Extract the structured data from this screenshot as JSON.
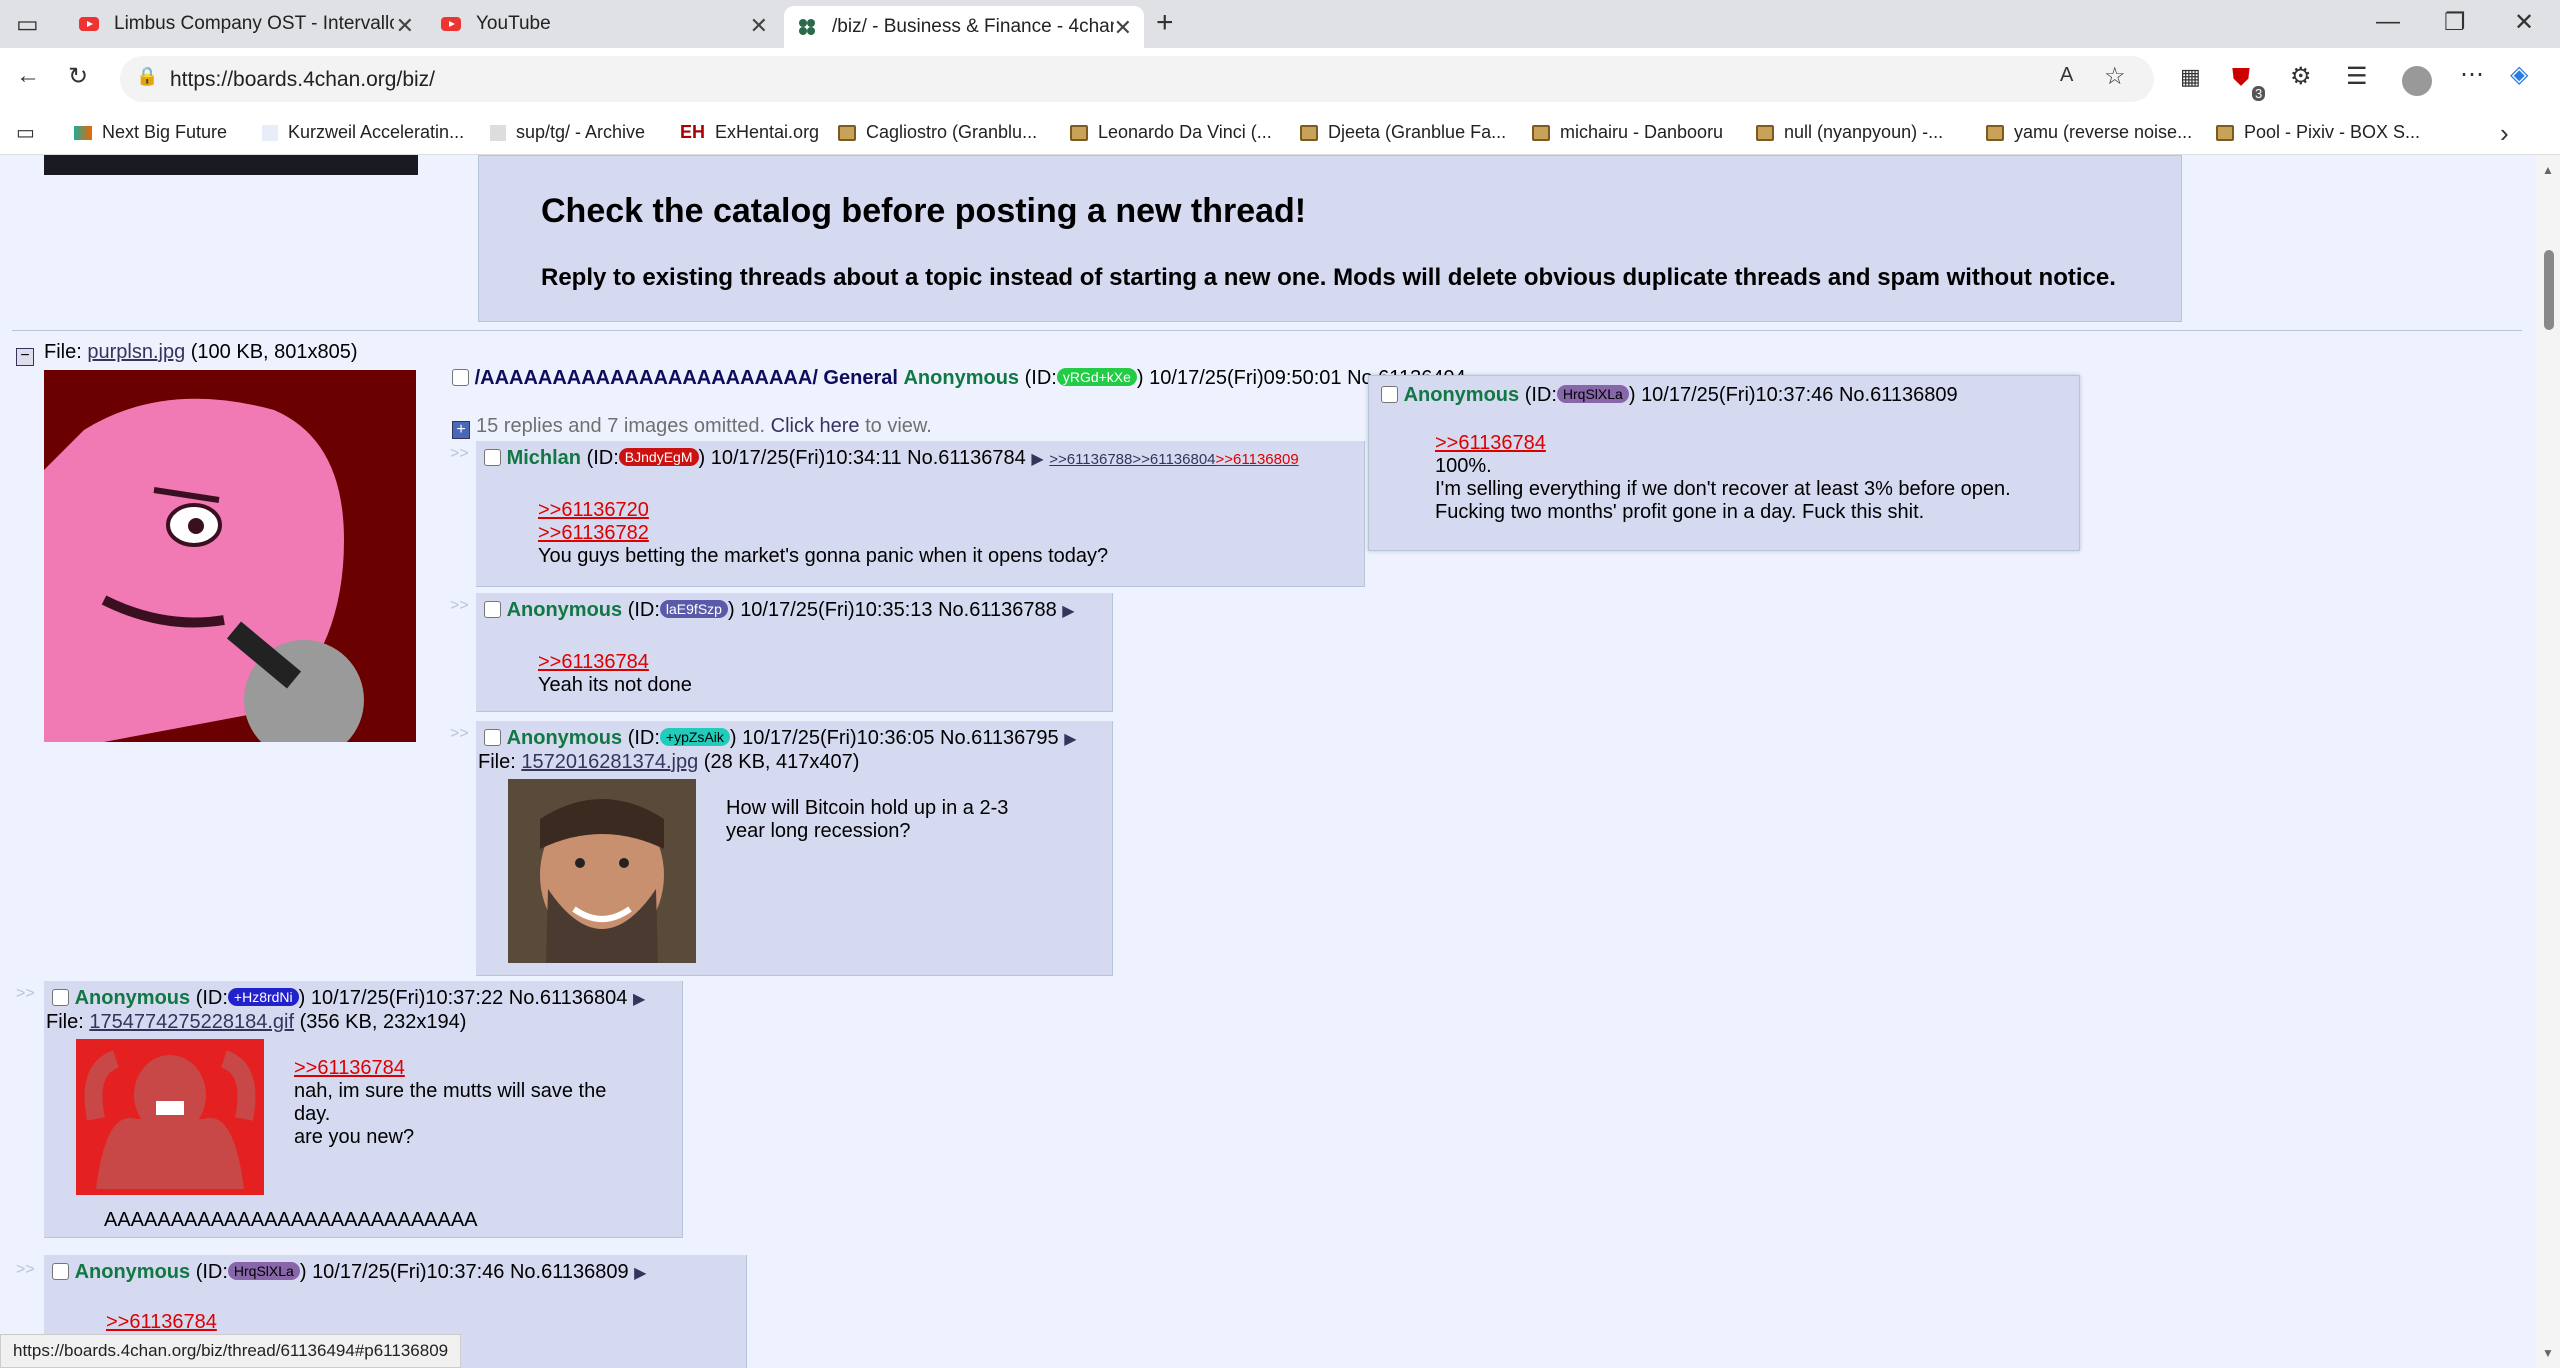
{
  "browser": {
    "tabs": [
      {
        "title": "Limbus Company OST - Intervallo",
        "icon": "youtube-icon"
      },
      {
        "title": "YouTube",
        "icon": "youtube-icon"
      },
      {
        "title": "/biz/ - Business & Finance - 4chan",
        "icon": "clover-icon"
      }
    ],
    "url": "https://boards.4chan.org/biz/",
    "bookmarks": [
      "Next Big Future",
      "Kurzweil Acceleratin...",
      "sup/tg/ - Archive",
      "ExHentai.org",
      "Cagliostro (Granblu...",
      "Leonardo Da Vinci (...",
      "Djeeta (Granblue Fa...",
      "michairu - Danbooru",
      "null (nyanpyoun) -...",
      "yamu (reverse noise...",
      "Pool - Pixiv - BOX S..."
    ],
    "extension_badge": "3"
  },
  "notice": {
    "title": "Check the catalog before posting a new thread!",
    "body": "Reply to existing threads about a topic instead of starting a new one. Mods will delete obvious duplicate threads and spam without notice."
  },
  "op": {
    "file_label": "File:",
    "file_name": "purplsn.jpg",
    "file_info": "(100 KB, 801x805)",
    "subject": "/AAAAAAAAAAAAAAAAAAAAAAA/ General",
    "name": "Anonymous",
    "id_prefix": "(ID:",
    "id": "yRGd+kXe",
    "id_suffix": ")",
    "datetime": "10/17/25(Fri)09:50:01",
    "postno": "No.61136494",
    "omitted": "15 replies and 7 images omitted.",
    "click_here": "Click here",
    "to_view": "to view."
  },
  "hover_preview": {
    "name": "Anonymous",
    "id_prefix": "(ID:",
    "id": "HrqSlXLa",
    "id_suffix": ")",
    "datetime": "10/17/25(Fri)10:37:46",
    "postno": "No.61136809",
    "quote": ">>61136784",
    "lines": [
      "100%.",
      "I'm selling everything if we don't recover at least 3% before open.",
      "Fucking two months' profit gone in a day. Fuck this shit."
    ]
  },
  "posts": [
    {
      "name": "Michlan",
      "id": "BJndyEgM",
      "datetime": "10/17/25(Fri)10:34:11",
      "postno": "No.61136784",
      "backlinks": [
        ">>61136788",
        ">>61136804",
        ">>61136809"
      ],
      "quotes": [
        ">>61136720",
        ">>61136782"
      ],
      "text": [
        "You guys betting the market's gonna panic when it opens today?"
      ]
    },
    {
      "name": "Anonymous",
      "id": "laE9fSzp",
      "datetime": "10/17/25(Fri)10:35:13",
      "postno": "No.61136788",
      "quotes": [
        ">>61136784"
      ],
      "text": [
        "Yeah its not done"
      ]
    },
    {
      "name": "Anonymous",
      "id": "+ypZsAik",
      "datetime": "10/17/25(Fri)10:36:05",
      "postno": "No.61136795",
      "file_name": "1572016281374.jpg",
      "file_info": "(28 KB, 417x407)",
      "text": [
        "How will Bitcoin hold up in a 2-3",
        "year long recession?"
      ]
    },
    {
      "name": "Anonymous",
      "id": "+Hz8rdNi",
      "datetime": "10/17/25(Fri)10:37:22",
      "postno": "No.61136804",
      "file_name": "1754774275228184.gif",
      "file_info": "(356 KB, 232x194)",
      "quotes": [
        ">>61136784"
      ],
      "text": [
        "nah, im sure the mutts will save the",
        "day.",
        "are you new?"
      ],
      "tail": "AAAAAAAAAAAAAAAAAAAAAAAAAAAA"
    },
    {
      "name": "Anonymous",
      "id": "HrqSlXLa",
      "datetime": "10/17/25(Fri)10:37:46",
      "postno": "No.61136809",
      "quotes": [
        ">>61136784"
      ]
    }
  ],
  "status_url": "https://boards.4chan.org/biz/thread/61136494#p61136809",
  "colors": {
    "name": "#117743",
    "quote": "#dd0000",
    "reply_bg": "#d6daf0",
    "page_bg": "#eef2ff"
  },
  "id_colors": [
    "#22cc44",
    "#cc1111",
    "#5a5aa8",
    "#22ccbb",
    "#2222cc",
    "#8866aa"
  ]
}
